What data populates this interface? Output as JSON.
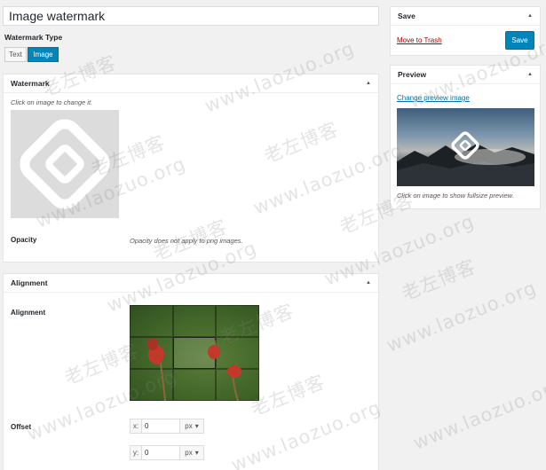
{
  "title_field": {
    "value": "Image watermark"
  },
  "watermark_type": {
    "label": "Watermark Type",
    "options": [
      "Text",
      "Image"
    ],
    "selected": "Image"
  },
  "watermark_box": {
    "title": "Watermark",
    "hint": "Click on image to change it.",
    "opacity_label": "Opacity",
    "opacity_note": "Opacity does not apply to png images."
  },
  "alignment_box": {
    "title": "Alignment",
    "label": "Alignment",
    "selected_cell": "middle-center",
    "offset_label": "Offset",
    "offset_x": {
      "axis": "x:",
      "value": "0",
      "unit": "px"
    },
    "offset_y": {
      "axis": "y:",
      "value": "0",
      "unit": "px"
    }
  },
  "save_box": {
    "title": "Save",
    "trash_label": "Move to Trash",
    "save_label": "Save"
  },
  "preview_box": {
    "title": "Preview",
    "change_label": "Change preview image",
    "note": "Click on image to show fullsize preview."
  },
  "overlay_watermark": {
    "cn": "老左博客",
    "url": "www.laozuo.org"
  },
  "colors": {
    "primary": "#0085ba",
    "link": "#0073aa",
    "trash": "#aa0000",
    "background": "#f1f1f1"
  }
}
